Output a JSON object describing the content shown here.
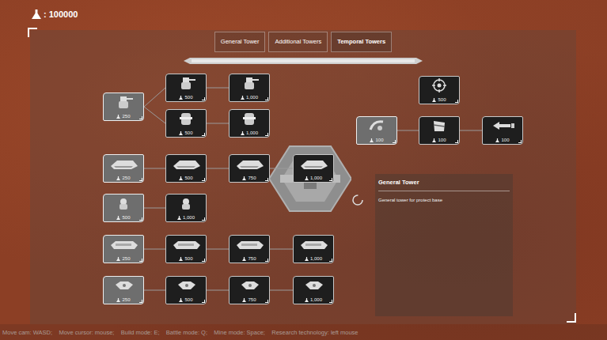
{
  "resources": {
    "value": ": 100000"
  },
  "tabs": [
    {
      "label": "General Tower",
      "selected": false
    },
    {
      "label": "Additional Towers",
      "selected": false
    },
    {
      "label": "Temporal Towers",
      "selected": true
    }
  ],
  "tree": {
    "nodes": [
      {
        "cost": "250",
        "unlocked": true
      },
      {
        "cost": "500",
        "unlocked": false
      },
      {
        "cost": "1,000",
        "unlocked": false
      },
      {
        "cost": "500",
        "unlocked": false
      },
      {
        "cost": "1,000",
        "unlocked": false
      },
      {
        "cost": "250",
        "unlocked": true
      },
      {
        "cost": "500",
        "unlocked": false
      },
      {
        "cost": "750",
        "unlocked": false
      },
      {
        "cost": "1,000",
        "unlocked": false
      },
      {
        "cost": "500",
        "unlocked": true
      },
      {
        "cost": "1,000",
        "unlocked": false
      },
      {
        "cost": "250",
        "unlocked": true
      },
      {
        "cost": "500",
        "unlocked": false
      },
      {
        "cost": "750",
        "unlocked": false
      },
      {
        "cost": "1,000",
        "unlocked": false
      },
      {
        "cost": "250",
        "unlocked": true
      },
      {
        "cost": "500",
        "unlocked": false
      },
      {
        "cost": "750",
        "unlocked": false
      },
      {
        "cost": "1,000",
        "unlocked": false
      },
      {
        "cost": "500",
        "unlocked": false
      },
      {
        "cost": "100",
        "unlocked": true
      },
      {
        "cost": "100",
        "unlocked": false
      },
      {
        "cost": "100",
        "unlocked": false
      }
    ]
  },
  "info_panel": {
    "title": "General Tower",
    "description": "General tower for protect base"
  },
  "status_bar": "Move cam: WASD;    Move cursor: mouse;    Build mode: E;    Battle mode: Q;    Mine mode: Space;    Research technology: left mouse"
}
